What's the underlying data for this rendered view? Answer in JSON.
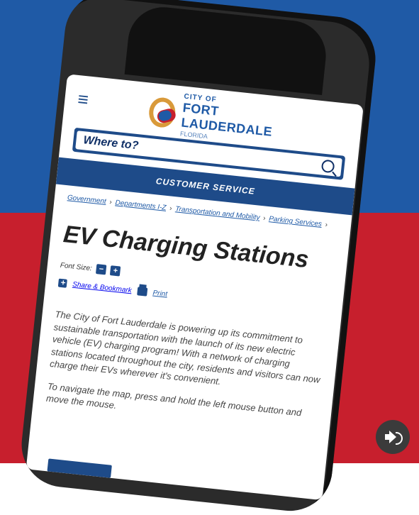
{
  "site": {
    "logo": {
      "small": "CITY OF",
      "big": "FORT LAUDERDALE",
      "state": "FLORIDA"
    },
    "search": {
      "label": "Where to?"
    },
    "banner": "CUSTOMER SERVICE",
    "breadcrumb": {
      "items": [
        "Government",
        "Departments I-Z",
        "Transportation and Mobility",
        "Parking Services"
      ],
      "seps": [
        "›",
        "›",
        "›",
        "›"
      ]
    },
    "page_title": "EV Charging Stations",
    "font_size_label": "Font Size:",
    "font_size_minus": "−",
    "font_size_plus": "+",
    "share_label": "Share & Bookmark",
    "print_label": "Print",
    "paragraphs": [
      "The City of Fort Lauderdale is powering up its commitment to sustainable transportation with the launch of its new electric vehicle (EV) charging program! With a network of charging stations located throughout the city, residents and visitors can now charge their EVs wherever it's convenient.",
      "To navigate the map, press and hold the left mouse button and move the mouse."
    ]
  },
  "colors": {
    "top_bg": "#1f5aa6",
    "bottom_bg": "#c71f2d",
    "site_blue": "#1e4b89",
    "logo_gold": "#d99a3a"
  }
}
